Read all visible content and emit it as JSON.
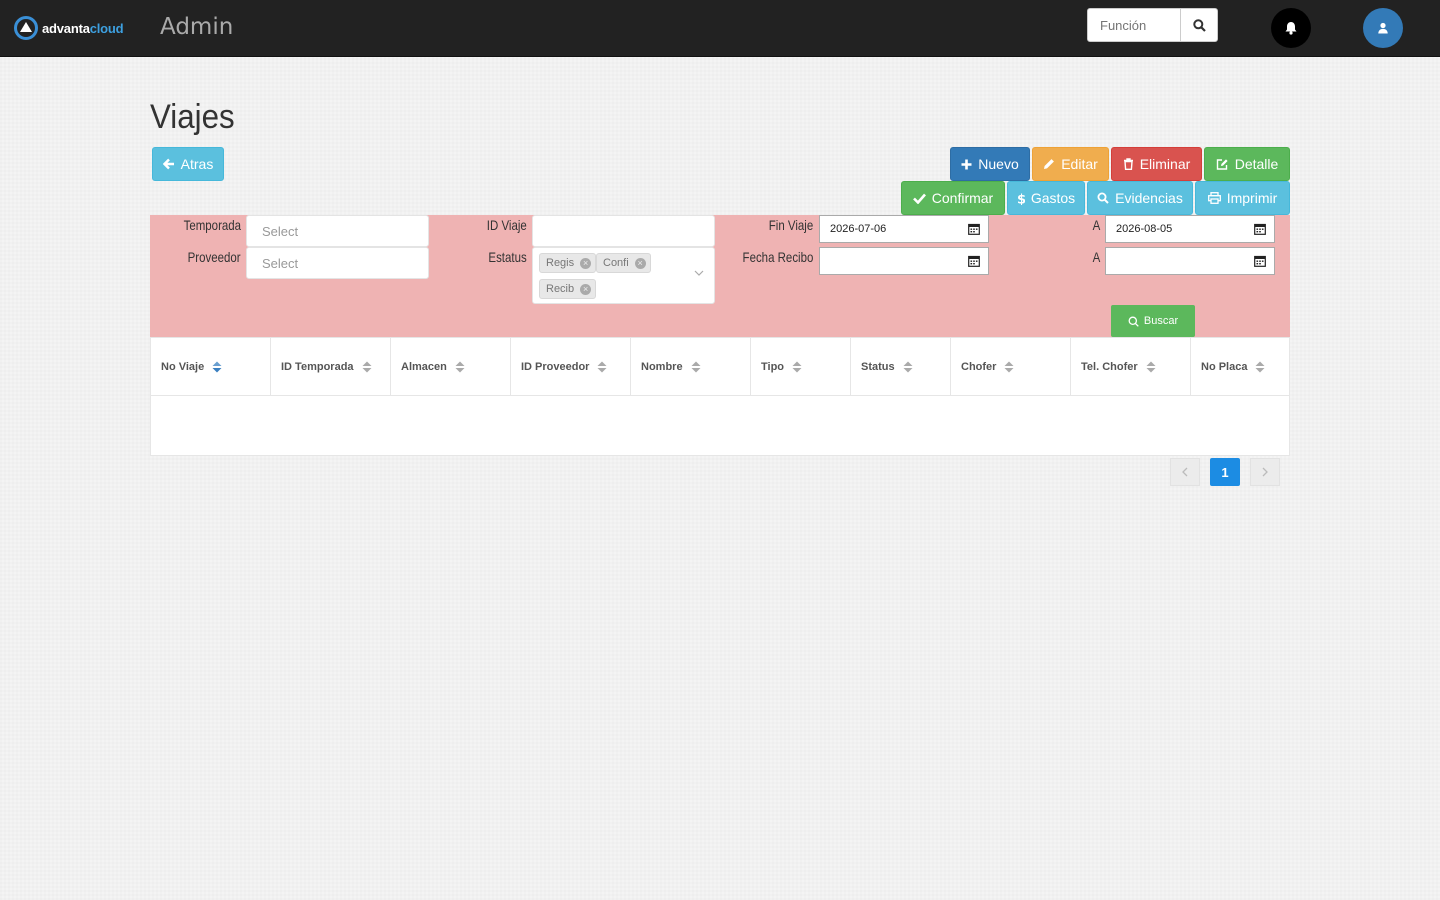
{
  "header": {
    "logo_text_a": "advanta",
    "logo_text_b": "cloud",
    "section": "Admin",
    "search_placeholder": "Función"
  },
  "page": {
    "title": "Viajes",
    "back_label": "Atras"
  },
  "toolbar": {
    "nuevo": "Nuevo",
    "editar": "Editar",
    "eliminar": "Eliminar",
    "detalle": "Detalle",
    "confirmar": "Confirmar",
    "gastos": "Gastos",
    "evidencias": "Evidencias",
    "imprimir": "Imprimir"
  },
  "filters": {
    "temporada_label": "Temporada",
    "temporada_placeholder": "Select",
    "proveedor_label": "Proveedor",
    "proveedor_placeholder": "Select",
    "id_viaje_label": "ID Viaje",
    "id_viaje_value": "",
    "estatus_label": "Estatus",
    "estatus_tags": [
      "Regis",
      "Confi",
      "Recib"
    ],
    "fin_viaje_label": "Fin Viaje",
    "fin_viaje_from": "2026-07-06",
    "fin_viaje_to_label": "A",
    "fin_viaje_to": "2026-08-05",
    "fecha_recibo_label": "Fecha Recibo",
    "fecha_recibo_from": "",
    "fecha_recibo_to_label": "A",
    "fecha_recibo_to": "",
    "search_button": "Buscar"
  },
  "table": {
    "columns": [
      "No Viaje",
      "ID Temporada",
      "Almacen",
      "ID Proveedor",
      "Nombre",
      "Tipo",
      "Status",
      "Chofer",
      "Tel. Chofer",
      "No Placa"
    ],
    "rows": []
  },
  "pagination": {
    "current_page": "1",
    "prev_icon": "chevron-left-icon",
    "next_icon": "chevron-right-icon"
  },
  "colors": {
    "topbar": "#222222",
    "filter_panel": "#efb3b3",
    "primary": "#337ab7",
    "info": "#5bc0de",
    "warning": "#f0ad4e",
    "danger": "#d9534f",
    "success": "#5cb85c"
  }
}
